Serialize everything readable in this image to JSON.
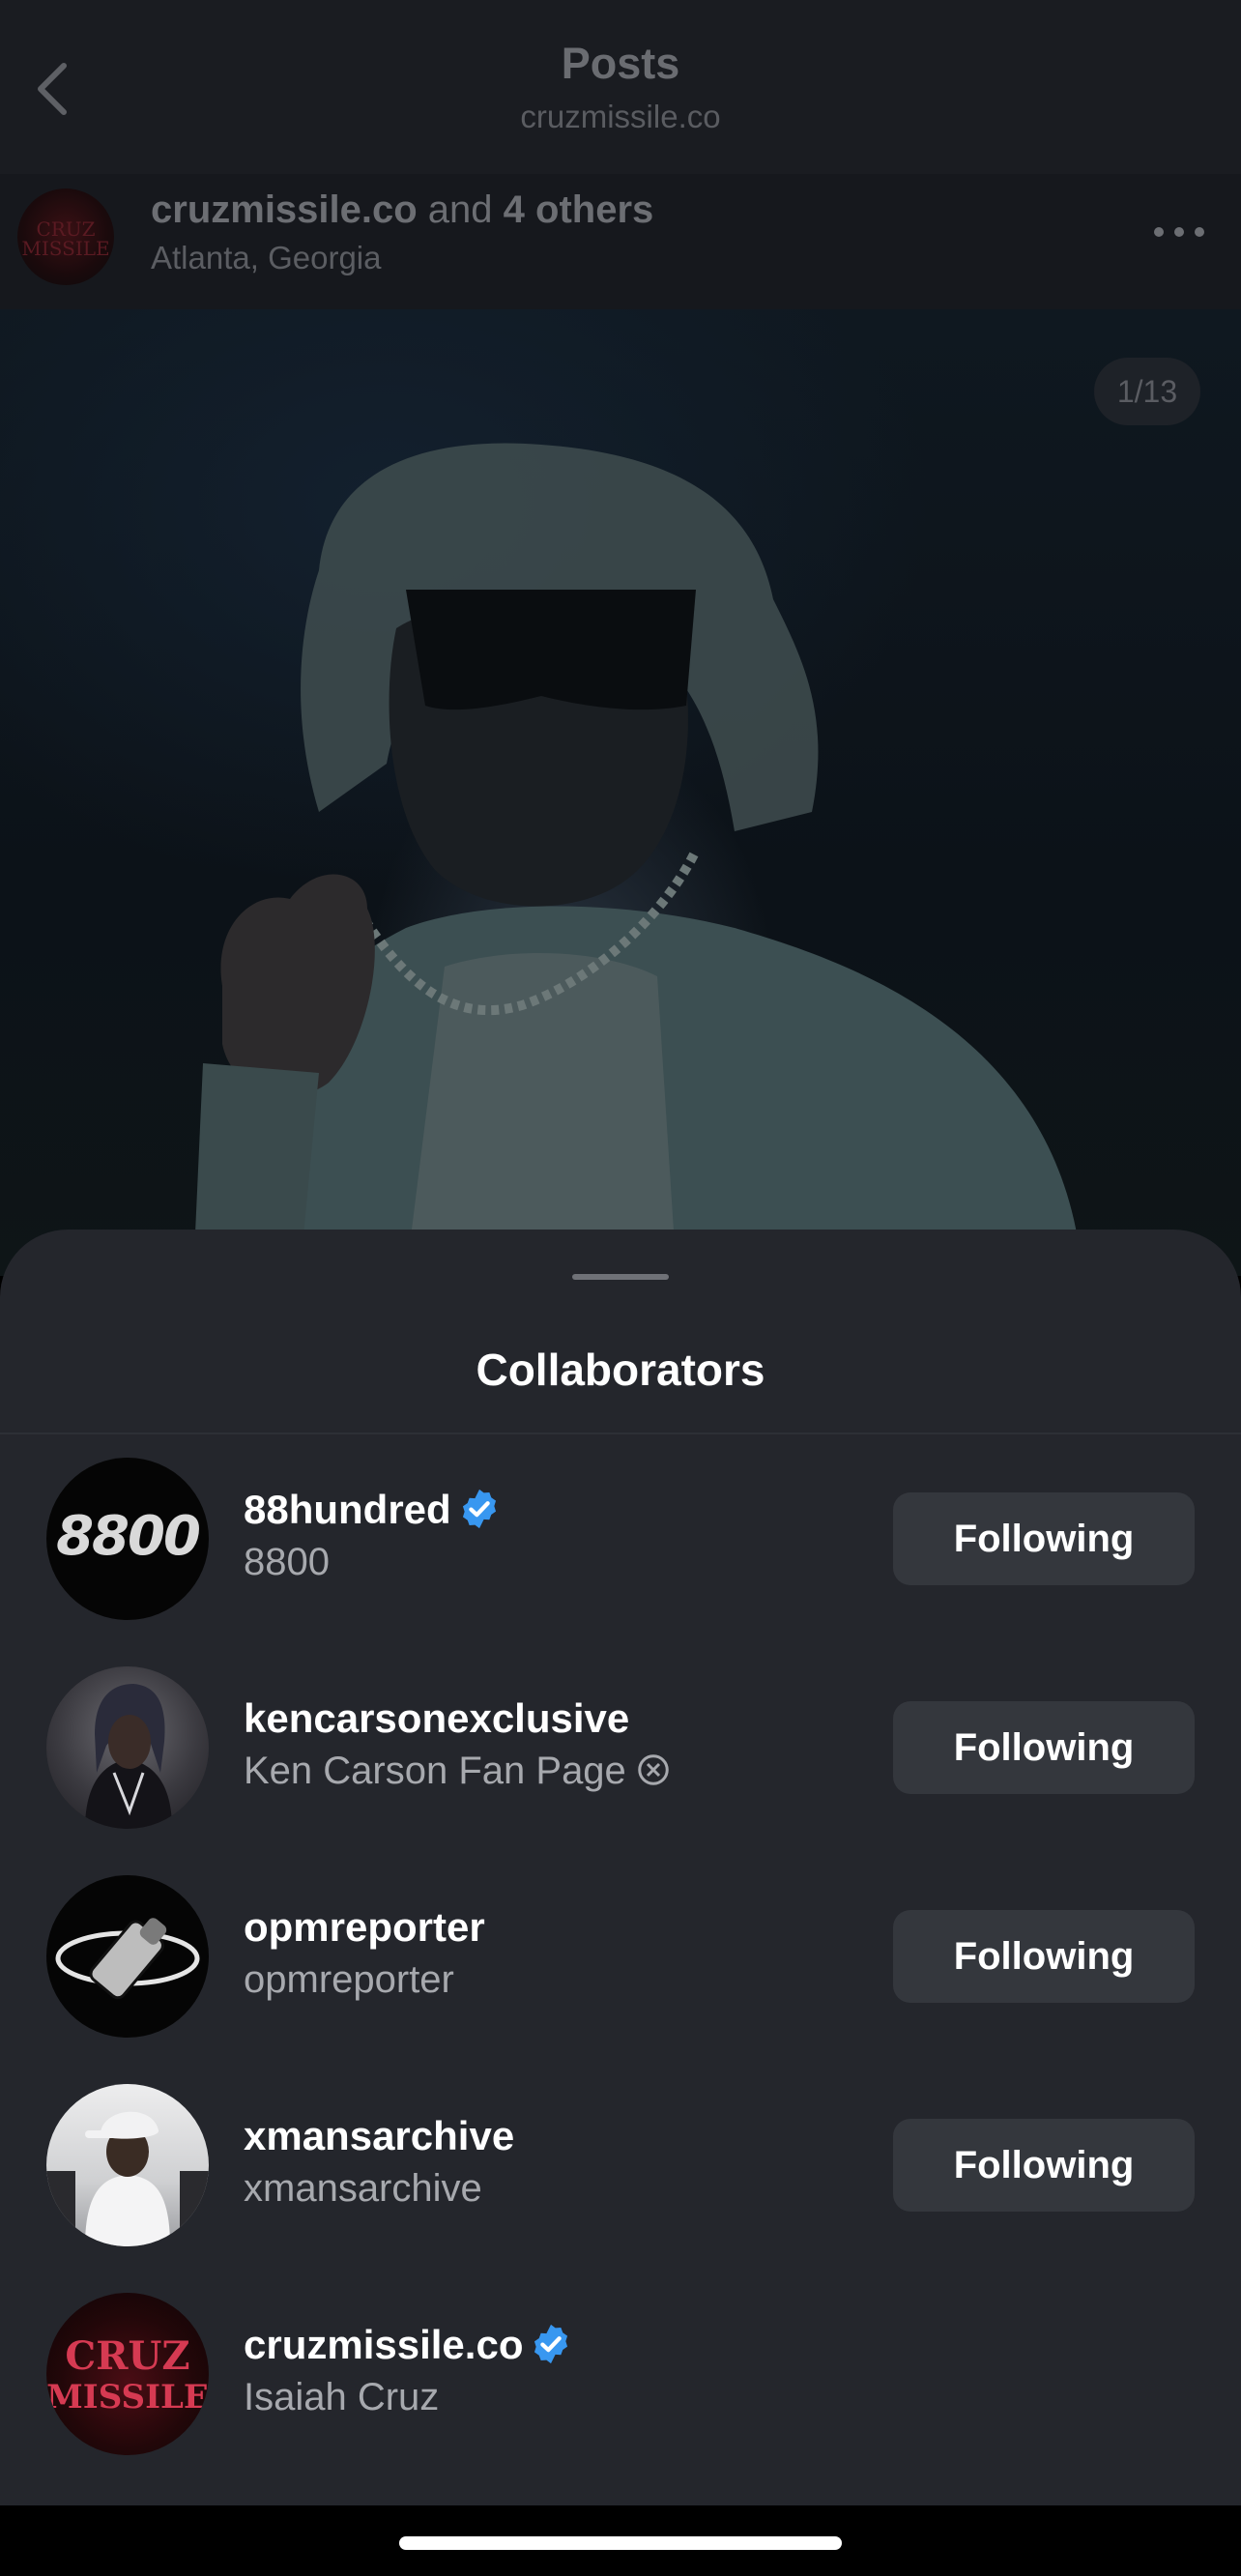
{
  "nav": {
    "title": "Posts",
    "subtitle": "cruzmissile.co",
    "back_icon": "chevron-left-icon"
  },
  "post": {
    "author": "cruzmissile.co",
    "joiner": " and ",
    "others": "4 others",
    "location": "Atlanta, Georgia",
    "avatar_text": "CRUZ MISSILE",
    "more_icon": "more-horizontal-icon",
    "counter": "1/13"
  },
  "sheet": {
    "title": "Collaborators",
    "collaborators": [
      {
        "username": "88hundred",
        "name": "8800",
        "verified": true,
        "button": "Following",
        "avatar_text": "8800"
      },
      {
        "username": "kencarsonexclusive",
        "name": "Ken Carson Fan Page",
        "name_icon": "x-circle-icon",
        "verified": false,
        "button": "Following"
      },
      {
        "username": "opmreporter",
        "name": "opmreporter",
        "verified": false,
        "button": "Following"
      },
      {
        "username": "xmansarchive",
        "name": "xmansarchive",
        "verified": false,
        "button": "Following"
      },
      {
        "username": "cruzmissile.co",
        "name": "Isaiah Cruz",
        "verified": true,
        "avatar_text_1": "CRUZ",
        "avatar_text_2": "MISSILE"
      }
    ]
  },
  "colors": {
    "verified_blue": "#3897f0",
    "sheet_bg": "#24262c",
    "button_bg": "#34373d"
  }
}
